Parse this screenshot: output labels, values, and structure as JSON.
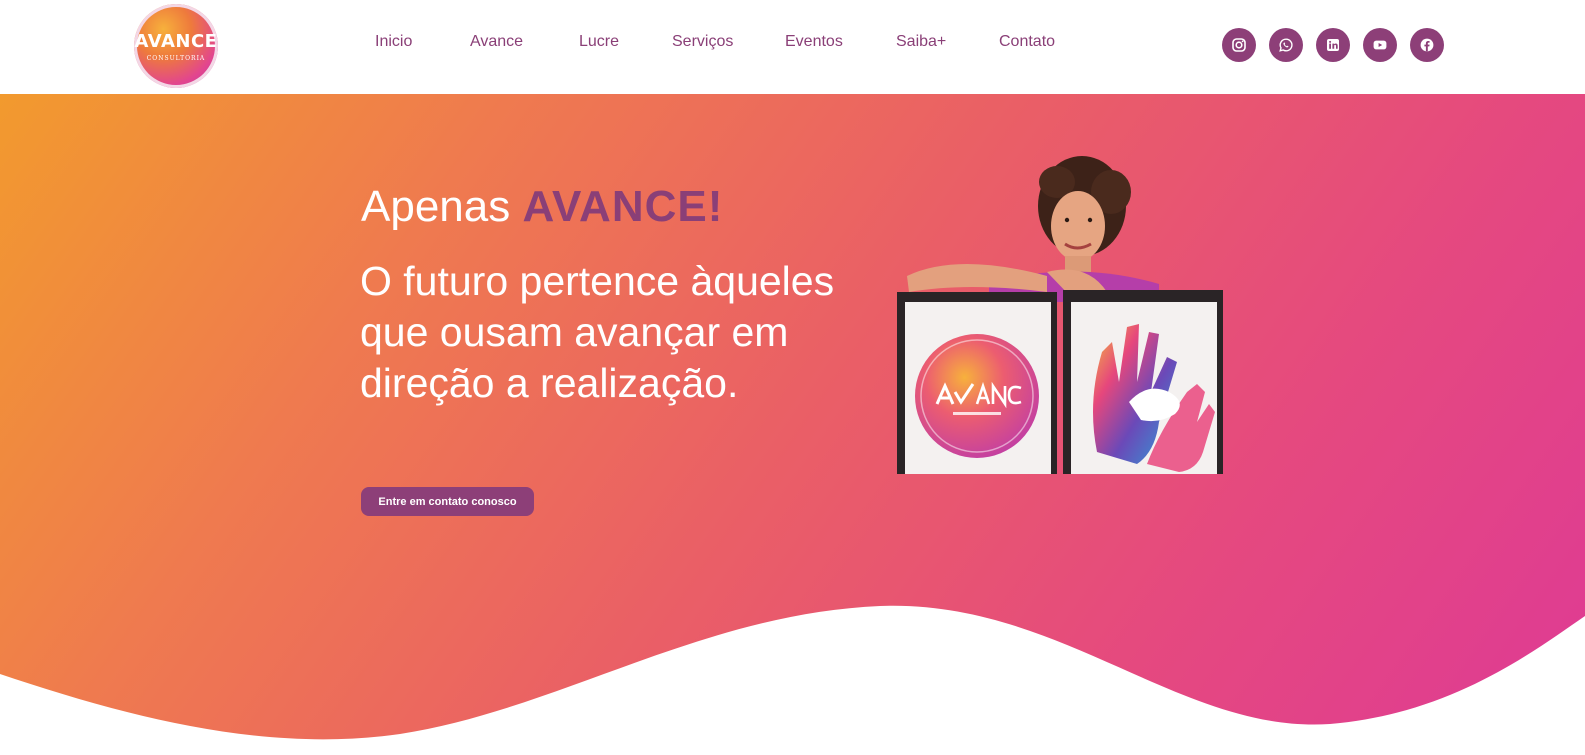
{
  "brand": {
    "logo_word": "AVANCE",
    "logo_sub": "CONSULTORIA"
  },
  "nav": {
    "items": [
      {
        "label": "Inicio"
      },
      {
        "label": "Avance"
      },
      {
        "label": "Lucre"
      },
      {
        "label": "Serviços"
      },
      {
        "label": "Eventos"
      },
      {
        "label": "Saiba+"
      },
      {
        "label": "Contato"
      }
    ]
  },
  "socials": [
    {
      "icon": "instagram-icon"
    },
    {
      "icon": "whatsapp-icon"
    },
    {
      "icon": "linkedin-icon"
    },
    {
      "icon": "youtube-icon"
    },
    {
      "icon": "facebook-icon"
    }
  ],
  "hero": {
    "title_prefix": "Apenas ",
    "title_accent": "AVANCE!",
    "subtitle": "O futuro pertence àqueles que ousam avançar em direção a realização.",
    "cta_label": "Entre em contato conosco"
  },
  "colors": {
    "accent": "#8d3f78",
    "gradient_start": "#f29a2e",
    "gradient_end": "#de3a95"
  }
}
